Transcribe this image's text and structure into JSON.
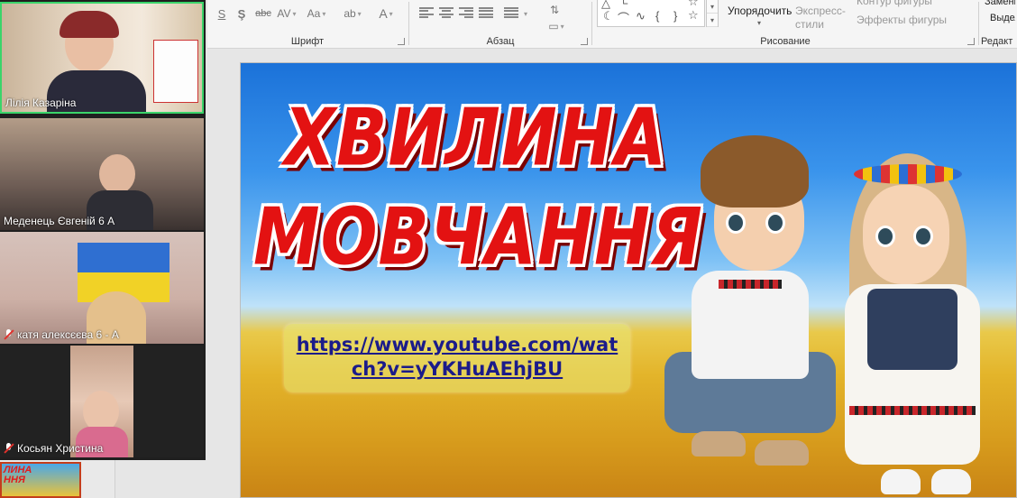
{
  "ribbon": {
    "groups": [
      {
        "id": "font",
        "label": "Шрифт"
      },
      {
        "id": "paragraph",
        "label": "Абзац"
      },
      {
        "id": "drawing",
        "label": "Рисование"
      },
      {
        "id": "editing",
        "label": "Редакт"
      }
    ],
    "arrange_label": "Упорядочить",
    "quick_styles_label": "Экспресс-стили",
    "shape_outline_label": "Контур фигуры",
    "shape_effects_label": "Эффекты фигуры",
    "replace_label": "Заменить",
    "select_label": "Выделить"
  },
  "participants": [
    {
      "name": "Лілія Казаріна",
      "muted": false,
      "active_speaker": true
    },
    {
      "name": "Меденець Євгеній 6 А",
      "muted": false,
      "active_speaker": false
    },
    {
      "name": "катя алексєєва 6 - А",
      "muted": true,
      "active_speaker": false
    },
    {
      "name": "Косьян Христина",
      "muted": true,
      "active_speaker": false
    }
  ],
  "slide": {
    "title_line1": "ХВИЛИНА",
    "title_line2": "МОВЧАННЯ",
    "link_line1": "https://www.youtube.com/wat",
    "link_line2": "ch?v=yYKHuAEhjBU"
  },
  "thumbnail": {
    "title_line1": "ЛИНА",
    "title_line2": "ННЯ"
  },
  "colors": {
    "title_red": "#e31212",
    "link_blue": "#1b1b8a",
    "active_speaker_border": "#3ad46a"
  }
}
